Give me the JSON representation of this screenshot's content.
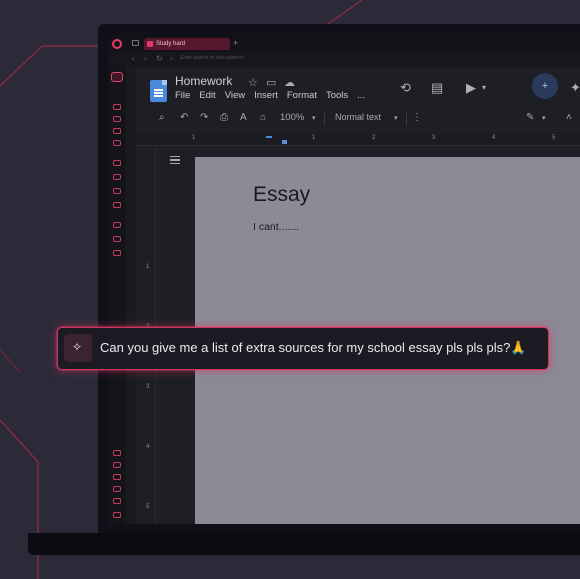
{
  "browser": {
    "tab_title": "Study hard",
    "address_placeholder": "Enter search or web address",
    "new_tab_symbol": "+"
  },
  "docs": {
    "doc_title": "Homework",
    "menu": [
      "File",
      "Edit",
      "View",
      "Insert",
      "Format",
      "Tools",
      "..."
    ],
    "zoom": "100%",
    "style": "Normal text",
    "ruler_numbers": [
      "1",
      "1",
      "2",
      "3",
      "4",
      "5",
      "6"
    ],
    "vruler_numbers": [
      "1",
      "2",
      "3",
      "4",
      "5"
    ]
  },
  "page": {
    "heading": "Essay",
    "body": "I cant......."
  },
  "prompt": {
    "text": "Can you give me a list of extra sources for my school essay pls pls pls?🙏",
    "icon": "sparkle-icon"
  },
  "colors": {
    "accent": "#d0345f",
    "background": "#2c2a39",
    "page": "#8b8a96"
  }
}
